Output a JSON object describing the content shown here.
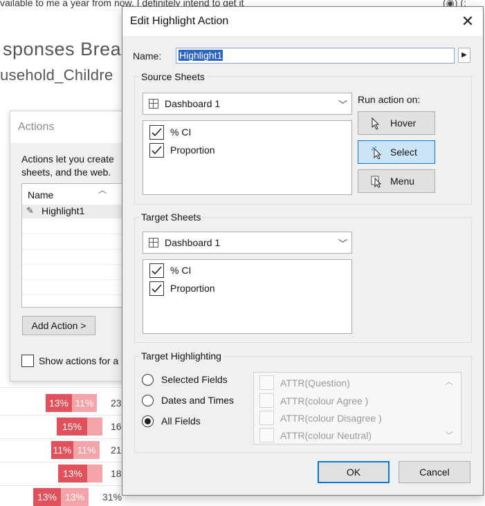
{
  "background": {
    "top_text": "vailable to me a year from now, I definitely intend to get it",
    "top_right": "(◉) (:",
    "title": "sponses Brea",
    "subtitle": "usehold_Childre",
    "bars": [
      {
        "a": "13%",
        "b": "11%",
        "c": "23"
      },
      {
        "a": "15%",
        "b": "",
        "c": "16"
      },
      {
        "a": "11%",
        "b": "11%",
        "c": "21"
      },
      {
        "a": "13%",
        "b": "",
        "c": "18"
      },
      {
        "a": "13%",
        "b": "13%",
        "c": "31%"
      }
    ]
  },
  "actions_window": {
    "title": "Actions",
    "description": "Actions let you create\nsheets, and the web.",
    "list_header": "Name",
    "row_label": "Highlight1",
    "add_action_label": "Add Action >",
    "show_actions_label": "Show actions for a"
  },
  "dialog": {
    "title": "Edit Highlight Action",
    "close_glyph": "✕",
    "name_label": "Name:",
    "name_value": "Highlight1",
    "source": {
      "group_title": "Source Sheets",
      "dropdown_value": "Dashboard 1",
      "sheets": [
        "% CI",
        "Proportion"
      ]
    },
    "run_on": {
      "label": "Run action on:",
      "hover": "Hover",
      "select": "Select",
      "menu": "Menu",
      "selected": "select"
    },
    "target": {
      "group_title": "Target Sheets",
      "dropdown_value": "Dashboard 1",
      "sheets": [
        "% CI",
        "Proportion"
      ]
    },
    "highlighting": {
      "group_title": "Target Highlighting",
      "options": [
        "Selected Fields",
        "Dates and Times",
        "All Fields"
      ],
      "selected_option": "All Fields",
      "fields": [
        "ATTR(Question)",
        "ATTR(colour Agree )",
        "ATTR(colour Disagree )",
        "ATTR(colour Neutral)"
      ]
    },
    "ok_label": "OK",
    "cancel_label": "Cancel"
  },
  "colors": {
    "accent": "#0078d7",
    "selection": "#2b63c4",
    "bar_dark": "#e0515b",
    "bar_light": "#f4a3a8"
  }
}
